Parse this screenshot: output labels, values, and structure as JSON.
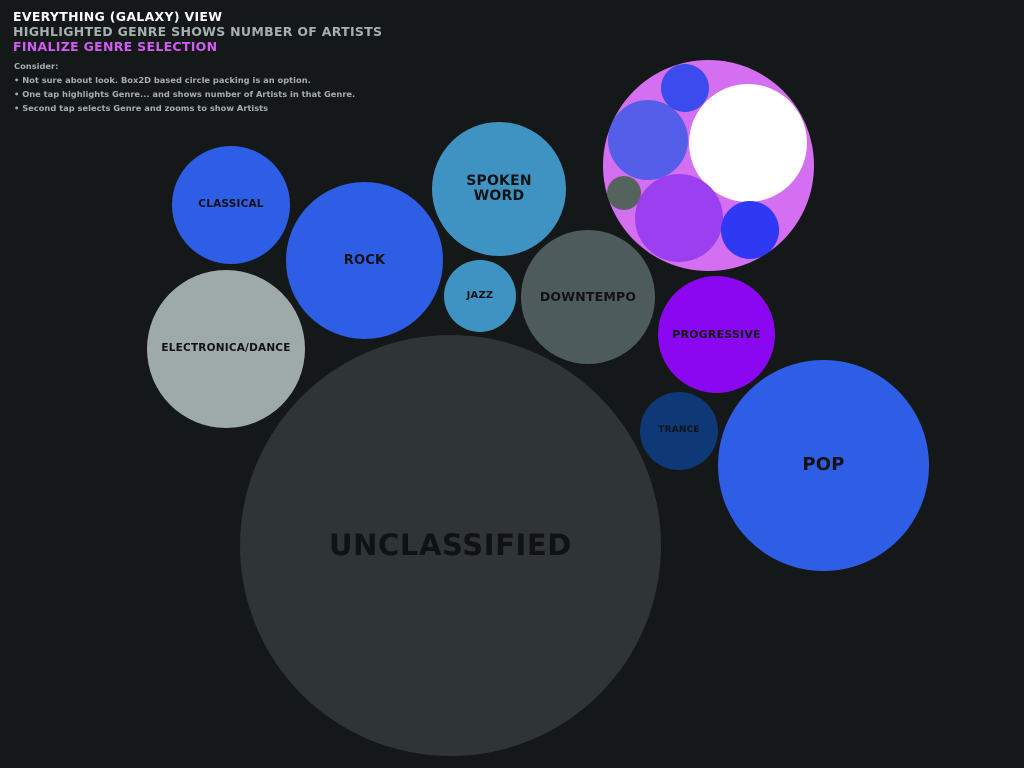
{
  "header": {
    "line_1": "EVERYTHING (GALAXY) VIEW",
    "line_2": "HIGHLIGHTED GENRE SHOWS NUMBER OF ARTISTS",
    "line_3": "FINALIZE GENRE SELECTION"
  },
  "notes": {
    "heading": "Consider:",
    "items": [
      "• Not sure about look. Box2D based circle packing is an option.",
      "• One tap highlights Genre... and shows number of Artists in that Genre.",
      "• Second tap selects Genre and zooms to show Artists"
    ]
  },
  "genres": {
    "classical": {
      "label": "CLASSICAL",
      "color": "#2f5ee6"
    },
    "rock": {
      "label": "ROCK",
      "color": "#2f5ee6"
    },
    "spoken_word": {
      "label": "SPOKEN WORD",
      "color": "#3e93c2"
    },
    "jazz": {
      "label": "JAZZ",
      "color": "#3e93c2"
    },
    "downtempo": {
      "label": "DOWNTEMPO",
      "color": "#4e5b5d"
    },
    "electronica_dance": {
      "label": "ELECTRONICA/DANCE",
      "color": "#9eaaa9"
    },
    "progressive": {
      "label": "PROGRESSIVE",
      "color": "#8b07f2"
    },
    "trance": {
      "label": "TRANCE",
      "color": "#0f3877"
    },
    "pop": {
      "label": "POP",
      "color": "#2f5ee6"
    },
    "unclassified": {
      "label": "UNCLASSIFIED",
      "color": "#2f3435"
    }
  },
  "selected_genre": {
    "color": "#d36ff0",
    "artist_circle_colors": [
      "#3b4bed",
      "#545ee8",
      "#ffffff",
      "#55625e",
      "#9b3ff0",
      "#2f38f2"
    ]
  },
  "colors": {
    "background": "#151819",
    "title_primary": "#ffffff",
    "title_secondary": "#a7b0b0",
    "title_accent": "#d15cf5"
  }
}
